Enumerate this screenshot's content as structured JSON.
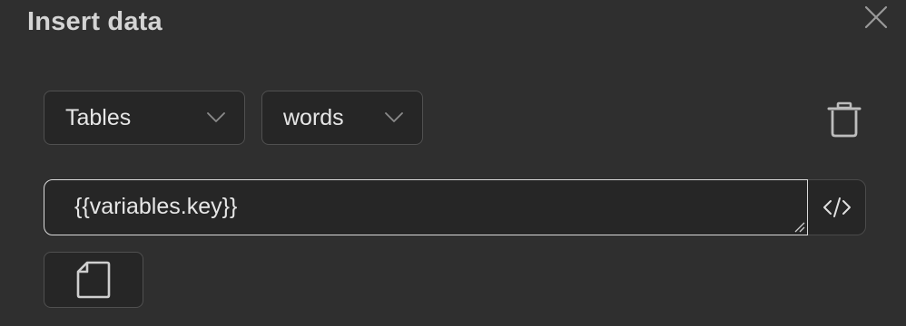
{
  "dialog": {
    "title": "Insert data",
    "close_icon": "close-icon"
  },
  "selectors": {
    "source": {
      "value": "Tables",
      "icon": "chevron-down-icon"
    },
    "table": {
      "value": "words",
      "icon": "chevron-down-icon"
    }
  },
  "actions": {
    "delete_icon": "trash-icon",
    "code_icon": "code-icon",
    "new_document_icon": "document-icon"
  },
  "expression": {
    "value": "{{variables.key}}"
  },
  "colors": {
    "background": "#2f2f2f",
    "control": "#262626",
    "border": "#505050",
    "focus_border": "#d9d9d9",
    "text": "#e6e6e6"
  }
}
